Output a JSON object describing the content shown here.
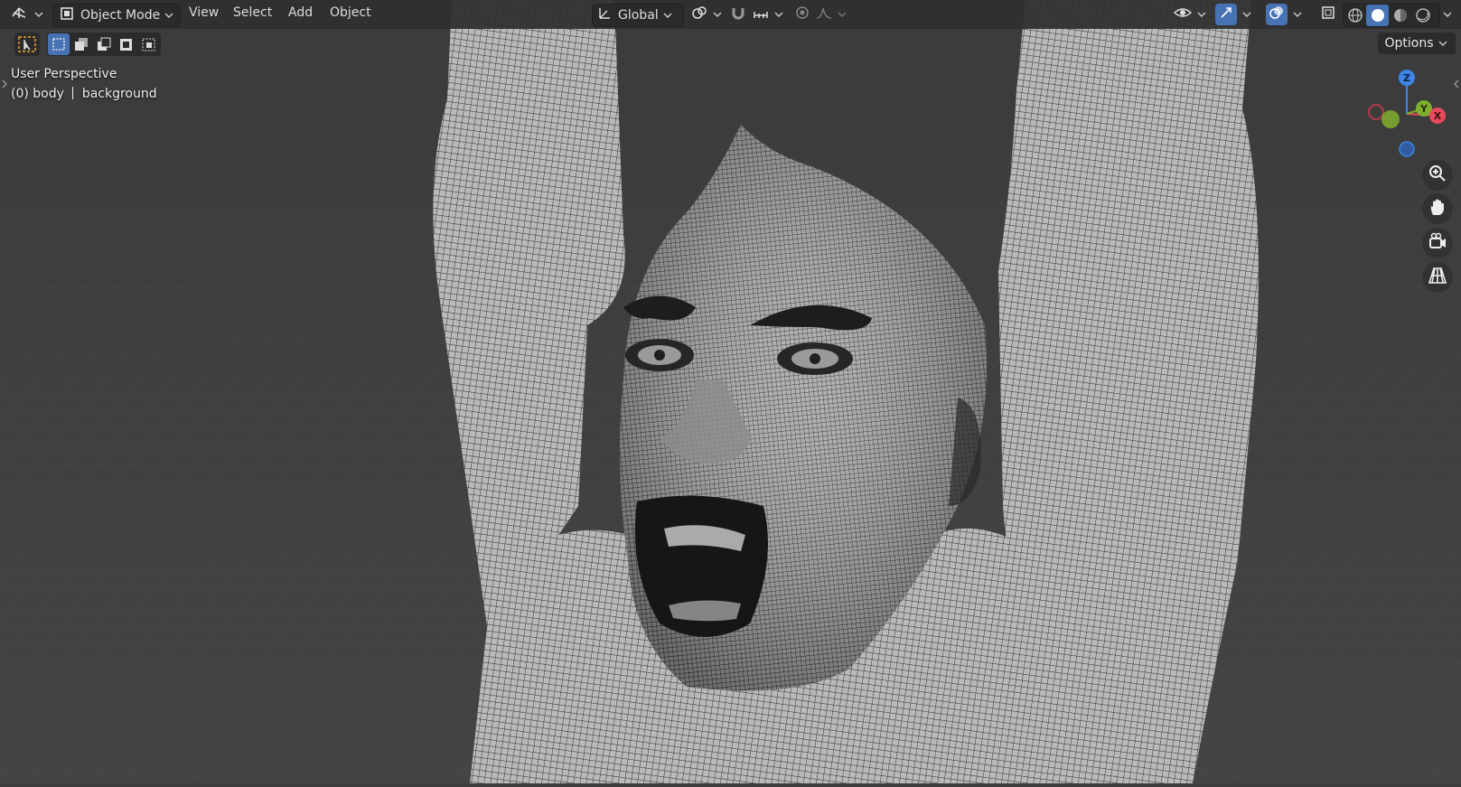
{
  "header": {
    "editor_type_icon": "3d-viewport-icon",
    "mode": "Object Mode",
    "menus": [
      "View",
      "Select",
      "Add",
      "Object"
    ],
    "transform_orientation": "Global"
  },
  "tool_settings": {
    "options_label": "Options"
  },
  "viewport": {
    "view_name": "User Perspective",
    "object_info_prefix": "(0) body",
    "object_info_suffix": "background"
  },
  "gizmo": {
    "axes": [
      "Z",
      "Y",
      "X"
    ],
    "colors": {
      "x": "#e8495a",
      "y": "#7fae2e",
      "z": "#3d84e4"
    }
  },
  "colors": {
    "header_bg": "#303030",
    "viewport_bg": "#3d3d3d",
    "accent": "#4772b3"
  }
}
